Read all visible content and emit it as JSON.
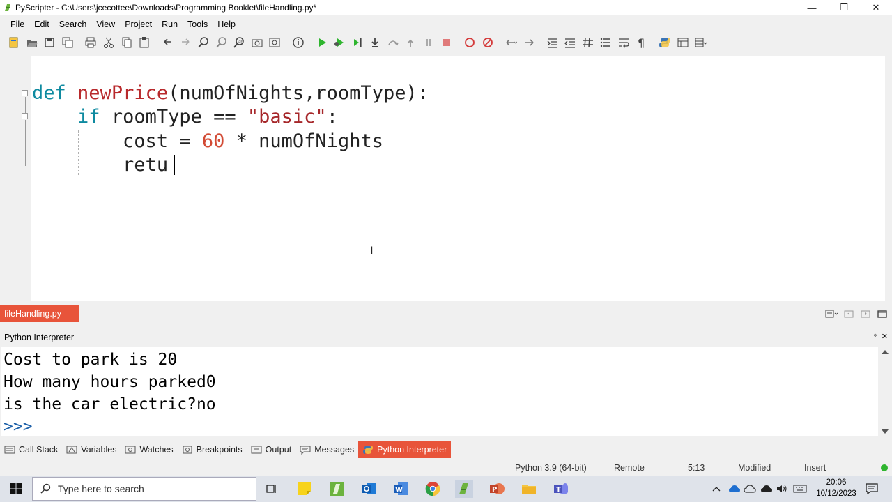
{
  "window": {
    "title": "PyScripter - C:\\Users\\jcecottee\\Downloads\\Programming Booklet\\fileHandling.py*",
    "minimize_glyph": "—",
    "restore_glyph": "❐",
    "close_glyph": "✕"
  },
  "menu": {
    "items": [
      {
        "label": "File"
      },
      {
        "label": "Edit"
      },
      {
        "label": "Search"
      },
      {
        "label": "View"
      },
      {
        "label": "Project"
      },
      {
        "label": "Run"
      },
      {
        "label": "Tools"
      },
      {
        "label": "Help"
      }
    ]
  },
  "toolbar": {
    "icons": [
      "new-file-icon",
      "open-icon",
      "save-icon",
      "save-all-icon",
      "print-icon",
      "cut-icon",
      "copy-icon",
      "paste-icon",
      "undo-icon",
      "redo-icon",
      "find-icon",
      "find-next-icon",
      "replace-icon",
      "find-in-files-icon",
      "goto-icon",
      "info-icon",
      "run-icon",
      "debug-icon",
      "run-to-cursor-icon",
      "step-into-icon",
      "step-over-icon",
      "step-out-icon",
      "pause-icon",
      "stop-icon",
      "toggle-breakpoint-icon",
      "clear-breakpoints-icon",
      "back-icon",
      "forward-icon",
      "indent-icon",
      "dedent-icon",
      "comment-icon",
      "list-icon",
      "word-wrap-icon",
      "pilcrow-icon",
      "python-icon",
      "layout-icon",
      "layout-menu-icon"
    ]
  },
  "editor": {
    "line1": {
      "kw": "def",
      "fn": "newPrice",
      "rest": "(numOfNights,roomType):"
    },
    "line2": {
      "kw": "if",
      "id": "roomType ==",
      "str": "\"basic\"",
      "tail": ":"
    },
    "line3": {
      "id": "cost =",
      "num": "60",
      "rest": "* numOfNights"
    },
    "line4": {
      "id": "retu"
    }
  },
  "file_tab": {
    "label": "fileHandling.py"
  },
  "interpreter": {
    "title": "Python Interpreter",
    "pin_glyph": "📌",
    "close_glyph": "✕",
    "lines": [
      "Cost to park is 20",
      "How many hours parked0",
      "is the car electric?no",
      ">>>"
    ]
  },
  "bottom_tabs": [
    {
      "label": "Call Stack",
      "icon": "call-stack-icon"
    },
    {
      "label": "Variables",
      "icon": "variables-icon"
    },
    {
      "label": "Watches",
      "icon": "watches-icon"
    },
    {
      "label": "Breakpoints",
      "icon": "breakpoints-icon"
    },
    {
      "label": "Output",
      "icon": "output-icon"
    },
    {
      "label": "Messages",
      "icon": "messages-icon"
    },
    {
      "label": "Python Interpreter",
      "icon": "python-icon",
      "active": true
    }
  ],
  "status": {
    "python": "Python 3.9 (64-bit)",
    "engine": "Remote",
    "position": "5:13",
    "modified": "Modified",
    "mode": "Insert"
  },
  "taskbar": {
    "search_placeholder": "Type here to search",
    "time": "20:06",
    "date": "10/12/2023"
  },
  "colors": {
    "accent": "#e8543a",
    "keyword": "#0e8aa0",
    "function": "#b8292c",
    "number": "#d24a34"
  }
}
